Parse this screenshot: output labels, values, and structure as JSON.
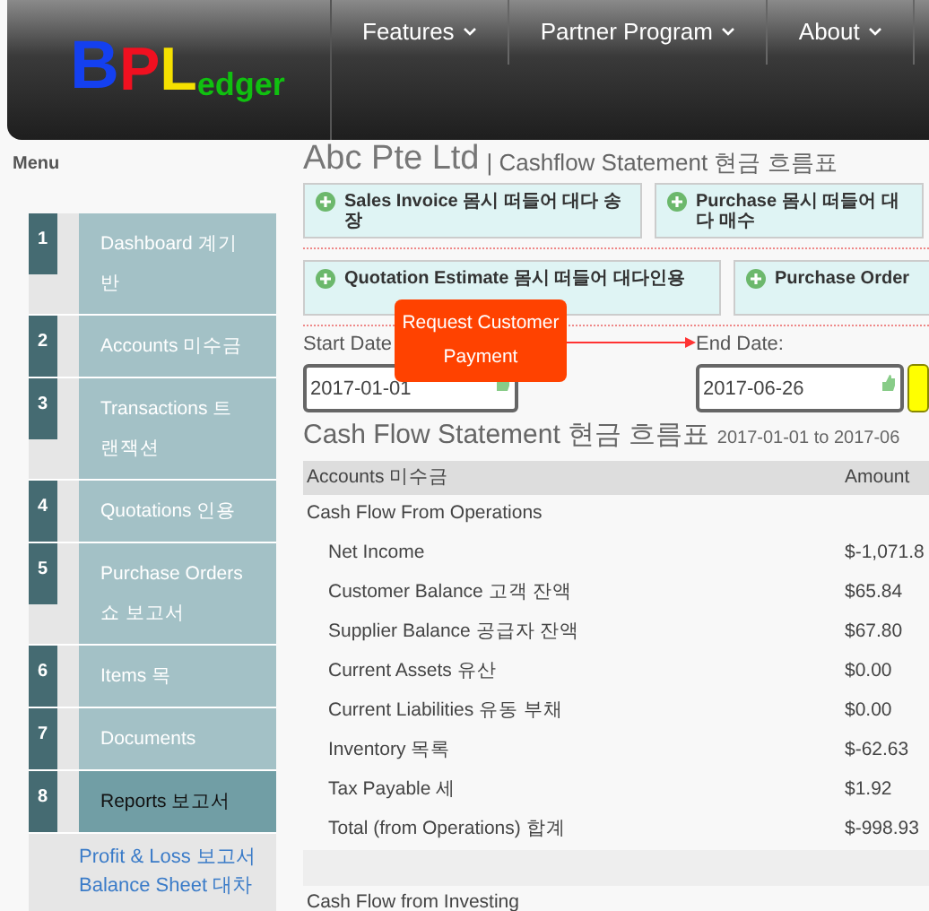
{
  "logo": {
    "letters": [
      {
        "text": "B",
        "color": "#1440f0"
      },
      {
        "text": "P",
        "color": "#f01020"
      },
      {
        "text": "L",
        "color": "#f5e000"
      },
      {
        "text": "edger",
        "color": "#10c010"
      }
    ]
  },
  "nav": [
    {
      "label": "Features"
    },
    {
      "label": "Partner Program"
    },
    {
      "label": "About"
    }
  ],
  "sidebar": {
    "title": "Menu",
    "items": [
      {
        "number": "1",
        "label": "Dashboard 계기반",
        "selected": false
      },
      {
        "number": "2",
        "label": "Accounts 미수금",
        "selected": false
      },
      {
        "number": "3",
        "label": "Transactions 트랜잭션",
        "selected": false
      },
      {
        "number": "4",
        "label": "Quotations 인용",
        "selected": false
      },
      {
        "number": "5",
        "label": "Purchase Orders 쇼 보고서",
        "selected": false
      },
      {
        "number": "6",
        "label": "Items 목",
        "selected": false
      },
      {
        "number": "7",
        "label": "Documents",
        "selected": false
      },
      {
        "number": "8",
        "label": "Reports 보고서",
        "selected": true,
        "children": [
          {
            "label": "Profit & Loss 보고서"
          },
          {
            "label": "Balance Sheet 대차"
          }
        ]
      }
    ]
  },
  "header": {
    "company": "Abc Pte Ltd",
    "subtitle": "| Cashflow Statement 현금 흐름표"
  },
  "action_rows": [
    [
      "Sales Invoice 몸시 떠들어 대다 송장",
      "Purchase 몸시 떠들어 대다 매수"
    ],
    [
      "Quotation Estimate 몸시 떠들어 대다인용",
      "Purchase Order"
    ]
  ],
  "dates": {
    "start_label": "Start Date",
    "start_value": "2017-01-01",
    "end_label": "End Date:",
    "end_value": "2017-06-26"
  },
  "callout": {
    "text": "Request Customer Payment"
  },
  "statement": {
    "title": "Cash Flow Statement 현금 흐름표",
    "range": "2017-01-01 to 2017-06",
    "columns": [
      "Accounts 미수금",
      "Amount"
    ],
    "rows": [
      {
        "kind": "section",
        "label": "Cash Flow From Operations"
      },
      {
        "kind": "item",
        "label": "Net Income",
        "amount": "$-1,071.8"
      },
      {
        "kind": "item",
        "label": "Customer Balance 고객 잔액",
        "amount": "$65.84"
      },
      {
        "kind": "item",
        "label": "Supplier Balance 공급자 잔액",
        "amount": "$67.80"
      },
      {
        "kind": "item",
        "label": "Current Assets 유산",
        "amount": "$0.00"
      },
      {
        "kind": "item",
        "label": "Current Liabilities 유동 부채",
        "amount": "$0.00"
      },
      {
        "kind": "item",
        "label": "Inventory 목록",
        "amount": "$-62.63"
      },
      {
        "kind": "item",
        "label": "Tax Payable 세",
        "amount": "$1.92"
      },
      {
        "kind": "item",
        "label": "Total (from Operations) 합계",
        "amount": "$-998.93"
      },
      {
        "kind": "spacer"
      },
      {
        "kind": "section",
        "label": "Cash Flow from Investing"
      }
    ]
  }
}
